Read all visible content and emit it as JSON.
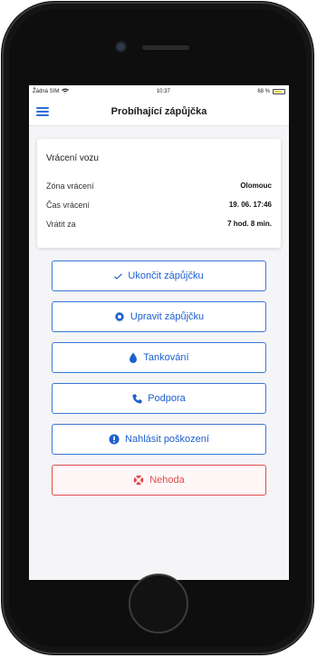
{
  "status_bar": {
    "carrier": "Žádná SIM",
    "time": "10:37",
    "battery": "68 %",
    "battery_level": 0.68
  },
  "nav": {
    "title": "Probíhající zápůjčka"
  },
  "return_card": {
    "title": "Vrácení vozu",
    "rows": [
      {
        "label": "Zóna vrácení",
        "value": "Olomouc"
      },
      {
        "label": "Čas vrácení",
        "value": "19. 06. 17:46"
      },
      {
        "label": "Vrátit za",
        "value": "7 hod. 8 min."
      }
    ]
  },
  "actions": [
    {
      "label": "Ukončit zápůjčku",
      "icon": "check-icon"
    },
    {
      "label": "Upravit zápůjčku",
      "icon": "gear-icon"
    },
    {
      "label": "Tankování",
      "icon": "drop-icon"
    },
    {
      "label": "Podpora",
      "icon": "phone-icon"
    },
    {
      "label": "Nahlásit poškození",
      "icon": "alert-icon"
    },
    {
      "label": "Nehoda",
      "icon": "lifebuoy-icon"
    }
  ],
  "colors": {
    "accent": "#1c5fcf",
    "danger": "#e14b4b",
    "battery": "#f6d21c"
  }
}
